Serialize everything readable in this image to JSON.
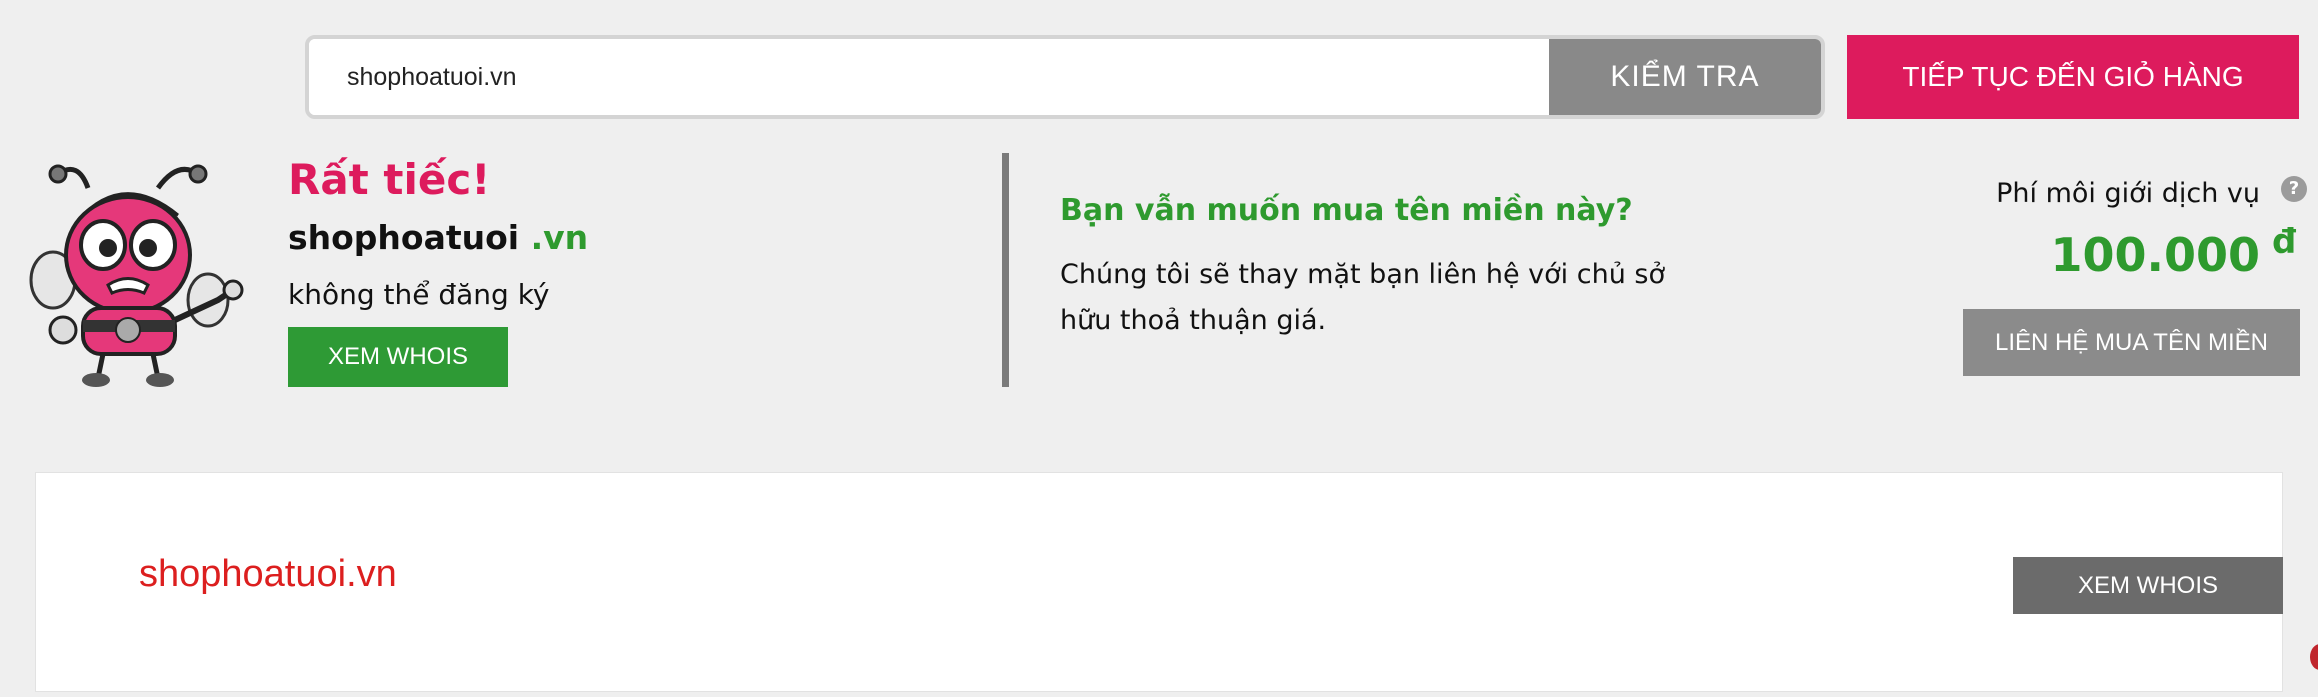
{
  "search": {
    "value": "shophoatuoi.vn",
    "check_label": "KIỂM TRA"
  },
  "cart_button": "TIẾP TỤC ĐẾN GIỎ HÀNG",
  "result": {
    "sorry": "Rất tiếc!",
    "domain_name": "shophoatuoi",
    "domain_tld": ".vn",
    "status": "không thể đăng ký",
    "whois_label": "XEM WHOIS"
  },
  "broker": {
    "question": "Bạn vẫn muốn mua tên miền này?",
    "description": "Chúng tôi sẽ thay mặt bạn liên hệ với chủ sở hữu thoả thuận giá.",
    "fee_label": "Phí môi giới dịch vụ",
    "help_icon": "?",
    "price": "100.000",
    "currency": "đ",
    "contact_label": "LIÊN HỆ MUA TÊN MIỀN"
  },
  "list": {
    "domain": "shophoatuoi.vn",
    "whois_label": "XEM WHOIS"
  },
  "colors": {
    "accent_pink": "#dd1b5d",
    "green": "#2e9a2e",
    "gray_button": "#898989",
    "red_text": "#dc1f1f"
  },
  "icons": {
    "mascot": "bee-mascot-icon",
    "help": "question-circle-icon"
  }
}
